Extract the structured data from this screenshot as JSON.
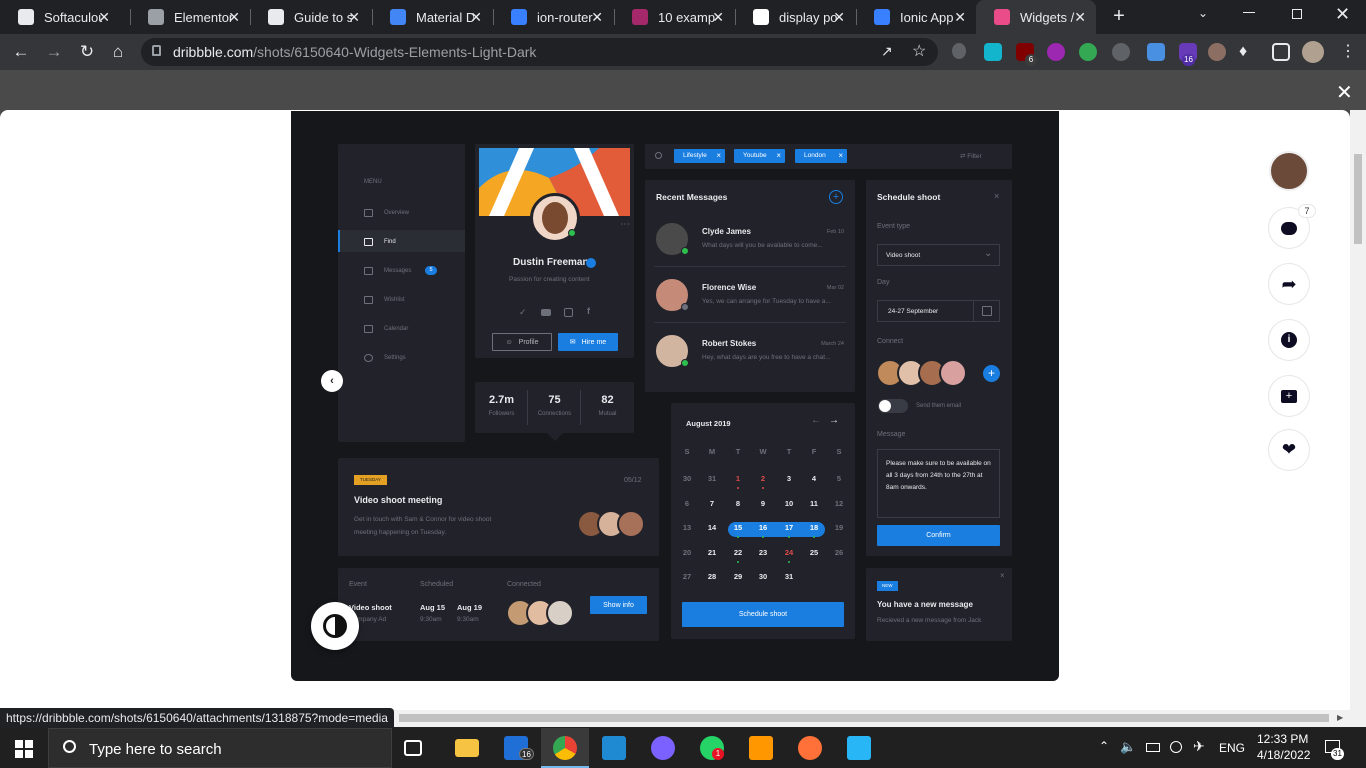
{
  "tabs": [
    {
      "title": "Softaculou",
      "icon": "softaculous-icon",
      "color": "#e8eaed"
    },
    {
      "title": "Elementor",
      "icon": "globe-icon",
      "color": "#9aa0a6"
    },
    {
      "title": "Guide to s",
      "icon": "github-icon",
      "color": "#e8eaed"
    },
    {
      "title": "Material D",
      "icon": "material-icon",
      "color": "#4285f4"
    },
    {
      "title": "ion-router",
      "icon": "ionic-icon",
      "color": "#3880ff"
    },
    {
      "title": "10 exampl",
      "icon": "yoast-icon",
      "color": "#a4286a"
    },
    {
      "title": "display po",
      "icon": "google-icon",
      "color": "#ffffff"
    },
    {
      "title": "Ionic App",
      "icon": "ionic-icon",
      "color": "#3880ff"
    },
    {
      "title": "Widgets /",
      "icon": "dribbble-icon",
      "color": "#ea4c89"
    }
  ],
  "address": {
    "domain": "dribbble.com",
    "path": "/shots/6150640-Widgets-Elements-Light-Dark"
  },
  "extension_badges": {
    "ext1": "6",
    "ext2": "16"
  },
  "status_url": "https://dribbble.com/shots/6150640/attachments/1318875?mode=media",
  "shot": {
    "menu": {
      "title": "MENU",
      "items": [
        "Overview",
        "Find",
        "Messages",
        "Wishlist",
        "Calendar",
        "Settings"
      ],
      "messages_badge": "5"
    },
    "profile": {
      "name": "Dustin Freeman",
      "tagline": "Passion for creating content",
      "profile_btn": "Profile",
      "hire_btn": "Hire me"
    },
    "stats": [
      {
        "value": "2.7m",
        "label": "Followers"
      },
      {
        "value": "75",
        "label": "Connections"
      },
      {
        "value": "82",
        "label": "Mutual"
      }
    ],
    "search_chips": [
      "Lifestyle",
      "Youtube",
      "London"
    ],
    "filter_label": "Filter",
    "messages": {
      "title": "Recent Messages",
      "items": [
        {
          "name": "Clyde James",
          "date": "Feb 10",
          "preview": "What days will you be available to come..."
        },
        {
          "name": "Florence Wise",
          "date": "Mar 02",
          "preview": "Yes, we can arrange for Tuesday to have a..."
        },
        {
          "name": "Robert Stokes",
          "date": "March 24",
          "preview": "Hey, what days are you free to have a chat..."
        }
      ]
    },
    "schedule": {
      "title": "Schedule shoot",
      "event_type_label": "Event type",
      "event_type_value": "Video shoot",
      "day_label": "Day",
      "day_value": "24-27 September",
      "connect_label": "Connect",
      "toggle_label": "Send them email",
      "message_label": "Message",
      "message_text": "Please make sure to be available on all 3 days from 24th to the 27th at 8am onwards.",
      "confirm": "Confirm"
    },
    "calendar": {
      "month": "August 2019",
      "weekdays": [
        "S",
        "M",
        "T",
        "W",
        "T",
        "F",
        "S"
      ],
      "weeks": [
        [
          "30",
          "31",
          "1",
          "2",
          "3",
          "4",
          "5"
        ],
        [
          "6",
          "7",
          "8",
          "9",
          "10",
          "11",
          "12"
        ],
        [
          "13",
          "14",
          "15",
          "16",
          "17",
          "18",
          "19"
        ],
        [
          "20",
          "21",
          "22",
          "23",
          "24",
          "25",
          "26"
        ],
        [
          "27",
          "28",
          "29",
          "30",
          "31",
          "",
          ""
        ]
      ],
      "button": "Schedule shoot"
    },
    "meeting": {
      "badge": "TUESDAY",
      "date": "05/12",
      "title": "Video shoot meeting",
      "desc1": "Get in touch with Sam & Connor for video shoot",
      "desc2": "meeting happening on Tuesday."
    },
    "event": {
      "headers": [
        "Event",
        "Scheduled",
        "Connected"
      ],
      "name": "Video shoot",
      "company": "Company Ad",
      "date1": "Aug 15",
      "time1": "9:30am",
      "date2": "Aug 19",
      "time2": "9:30am",
      "button": "Show info"
    },
    "notification": {
      "badge": "NEW",
      "title": "You have a new message",
      "text": "Recieved a new message from Jack"
    }
  },
  "sidebar_comments_count": "7",
  "taskbar": {
    "search_placeholder": "Type here to search",
    "time": "12:33 PM",
    "date": "4/18/2022",
    "lang": "ENG",
    "mail_badge": "16",
    "whatsapp_badge": "1",
    "notif_badge": "31"
  }
}
